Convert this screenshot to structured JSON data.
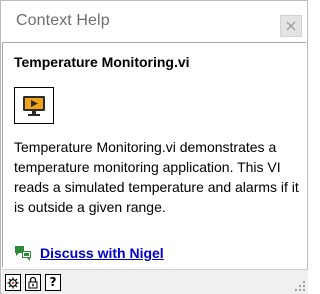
{
  "window": {
    "title": "Context Help"
  },
  "vi": {
    "name": "Temperature Monitoring.vi",
    "description": "Temperature Monitoring.vi demonstrates a temperature monitoring application.  This VI reads a simulated temperature and alarms if it is outside a given range.",
    "discuss_label": "Discuss with Nigel"
  },
  "toolbar": {
    "help_glyph": "?"
  },
  "icons": {
    "close": "close-icon",
    "vi": "vi-monitor-icon",
    "discuss": "chat-bubbles-icon",
    "show_optional": "show-optional-terminals-icon",
    "lock": "lock-icon",
    "help": "detailed-help-icon",
    "resize": "resize-grip-icon"
  },
  "colors": {
    "link": "#0000cc",
    "title_text": "#6d6d6d",
    "discuss_icon": "#2e8b3a"
  }
}
